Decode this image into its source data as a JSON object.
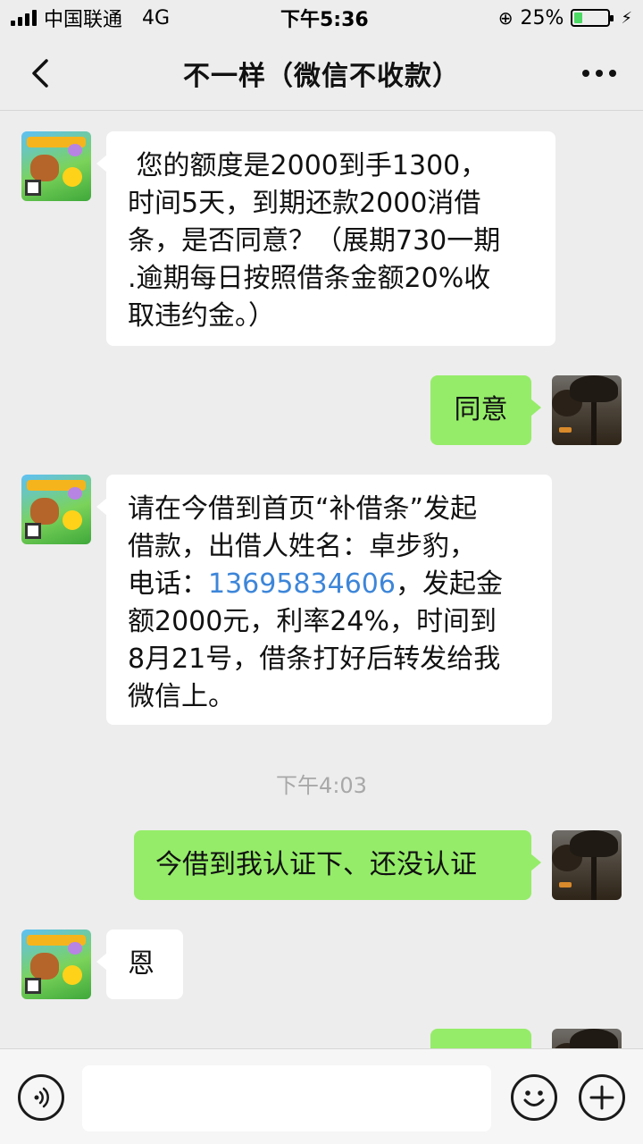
{
  "status_bar": {
    "carrier": "中国联通",
    "network": "4G",
    "time": "下午5:36",
    "battery": "25%",
    "battery_level": 0.25
  },
  "nav": {
    "title": "不一样（微信不收款）"
  },
  "messages": [
    {
      "side": "left",
      "text": " 您的额度是2000到手1300，\n时间5天，到期还款2000消借\n条，是否同意？（展期730一期\n.逾期每日按照借条金额20%收\n取违约金。）"
    },
    {
      "side": "right",
      "text": "同意"
    },
    {
      "side": "left",
      "text_before": "请在今借到首页“补借条”发起\n借款，出借人姓名：卓步豹，\n电话：",
      "phone": "13695834606",
      "text_after": "，发起金\n额2000元，利率24%，时间到\n8月21号，借条打好后转发给我\n微信上。"
    },
    {
      "type": "timestamp",
      "text": "下午4:03"
    },
    {
      "side": "right",
      "text": "今借到我认证下、还没认证"
    },
    {
      "side": "left",
      "text": "恩"
    }
  ],
  "colors": {
    "background": "#ededed",
    "bubble_self": "#95ec69",
    "bubble_other": "#ffffff",
    "link": "#3d86d9"
  },
  "icons": {
    "back": "chevron-left-icon",
    "more": "more-dots-icon",
    "voice": "voice-icon",
    "emoji": "emoji-icon",
    "add": "plus-icon"
  }
}
